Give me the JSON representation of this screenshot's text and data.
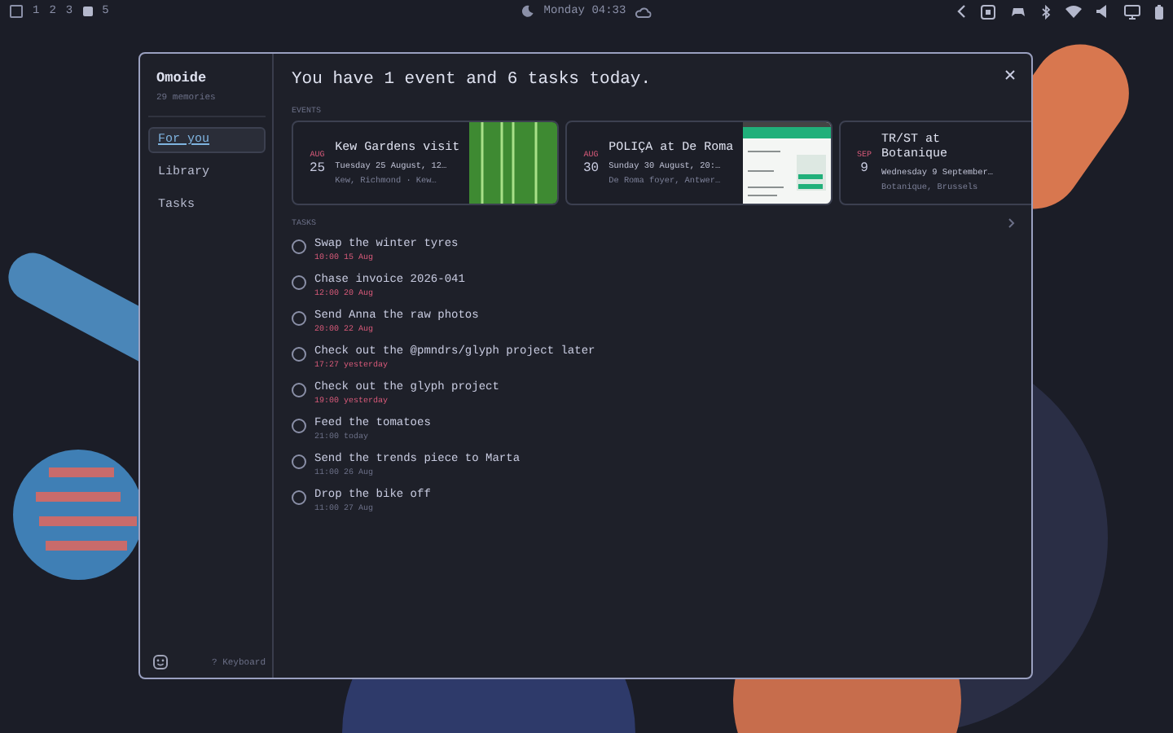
{
  "top_bar": {
    "workspaces": [
      {
        "label": "1",
        "selected": false
      },
      {
        "label": "2",
        "selected": false
      },
      {
        "label": "3",
        "selected": false
      },
      {
        "label": "5",
        "selected": false
      }
    ],
    "clock": "Monday 04:33"
  },
  "sidebar": {
    "title": "Omoide",
    "subtitle": "29 memories",
    "items": [
      {
        "label": "For you",
        "selected": true
      },
      {
        "label": "Library",
        "selected": false
      },
      {
        "label": "Tasks",
        "selected": false
      }
    ],
    "footer_hint": "? Keyboard"
  },
  "headline": "You have 1 event and 6 tasks today.",
  "events_heading": "EVENTS",
  "events": [
    {
      "month": "AUG",
      "day": "25",
      "title": "Kew Gardens visit",
      "when": "Tuesday 25 August, 12…",
      "where": "Kew, Richmond  ·  Kew…",
      "kind": "photo"
    },
    {
      "month": "AUG",
      "day": "30",
      "title": "POLIÇA at De Roma",
      "when": "Sunday 30 August, 20:…",
      "where": "De Roma foyer, Antwer…",
      "kind": "screenshot"
    },
    {
      "month": "SEP",
      "day": "9",
      "title": "TR/ST at Botanique",
      "when": "Wednesday 9 September…",
      "where": "Botanique, Brussels",
      "kind": "plain"
    }
  ],
  "tasks_heading": "TASKS",
  "tasks": [
    {
      "title": "Swap the winter tyres",
      "due": "10:00 15 Aug",
      "overdue": true,
      "checked": false
    },
    {
      "title": "Chase invoice 2026-041",
      "due": "12:00 20 Aug",
      "overdue": true,
      "checked": false
    },
    {
      "title": "Send Anna the raw photos",
      "due": "20:00 22 Aug",
      "overdue": true,
      "checked": false
    },
    {
      "title": "Check out the @pmndrs/glyph project later",
      "due": "17:27 yesterday",
      "overdue": true,
      "checked": false
    },
    {
      "title": "Check out the glyph project",
      "due": "19:00 yesterday",
      "overdue": true,
      "checked": false
    },
    {
      "title": "Feed the tomatoes",
      "due": "21:00 today",
      "overdue": false,
      "checked": false
    },
    {
      "title": "Send the trends piece to Marta",
      "due": "11:00 26 Aug",
      "overdue": false,
      "checked": false
    },
    {
      "title": "Drop the bike off",
      "due": "11:00 27 Aug",
      "overdue": false,
      "checked": false
    }
  ]
}
